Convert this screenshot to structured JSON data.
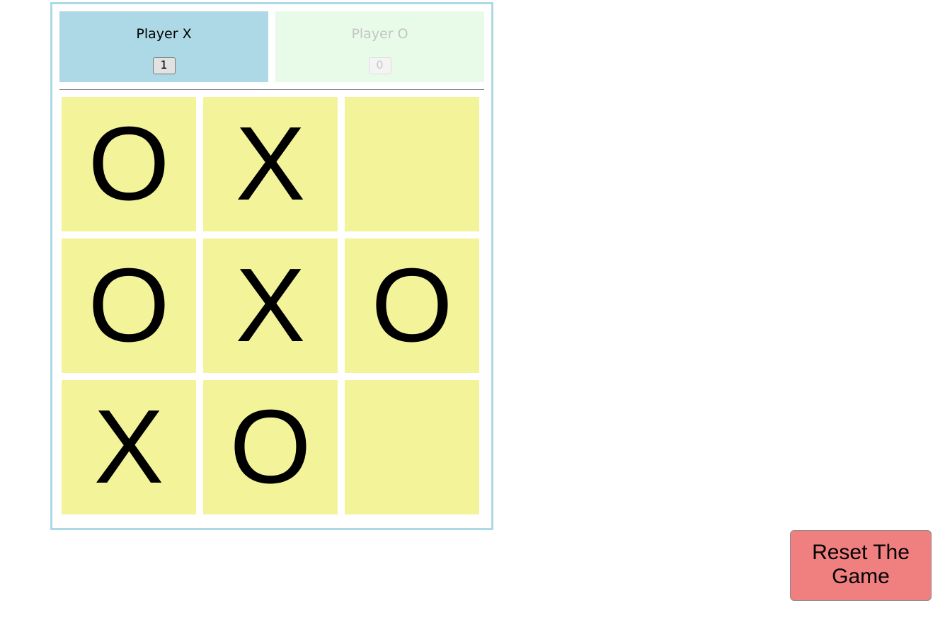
{
  "players": [
    {
      "name": "Player X",
      "score": "1",
      "active": true
    },
    {
      "name": "Player O",
      "score": "0",
      "active": false
    }
  ],
  "board": {
    "cells": [
      "O",
      "X",
      "",
      "O",
      "X",
      "O",
      "X",
      "O",
      ""
    ]
  },
  "reset_label": "Reset The Game",
  "colors": {
    "frame_border": "#add8e6",
    "player_x_bg": "#add8e6",
    "player_o_bg": "#e8fbe8",
    "cell_bg": "#f3f499",
    "reset_bg": "#f08080"
  }
}
